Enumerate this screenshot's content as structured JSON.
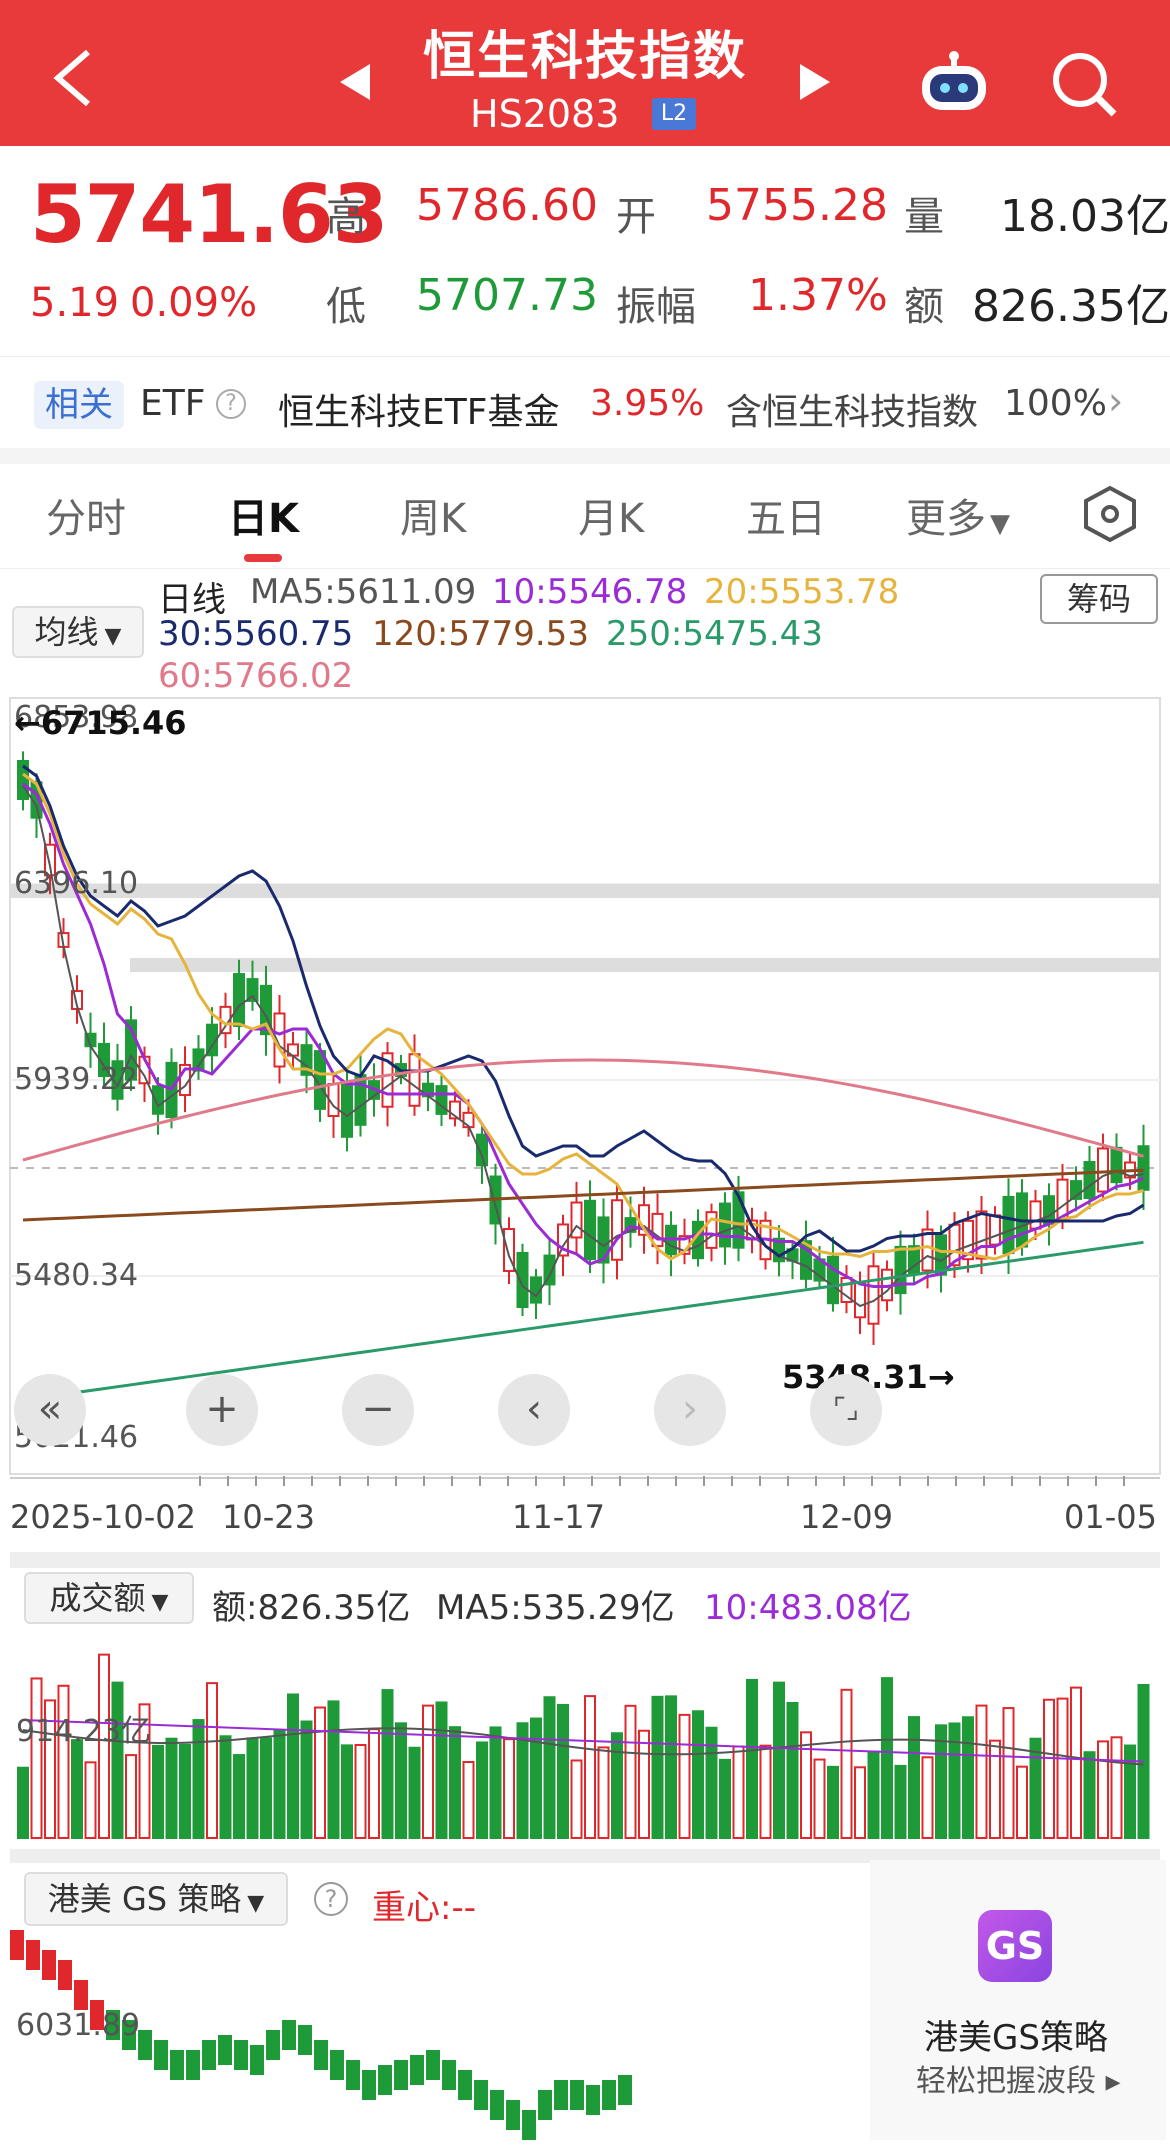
{
  "header": {
    "title": "恒生科技指数",
    "code": "HS2083",
    "badge": "L2"
  },
  "quote": {
    "price": "5741.63",
    "change": "5.19",
    "change_pct": "0.09%",
    "high_label": "高",
    "high": "5786.60",
    "open_label": "开",
    "open": "5755.28",
    "volume_label": "量",
    "volume": "18.03亿",
    "low_label": "低",
    "low": "5707.73",
    "amplitude_label": "振幅",
    "amplitude": "1.37%",
    "turnover_label": "额",
    "turnover": "826.35亿"
  },
  "etf": {
    "tag": "相关",
    "label": "ETF",
    "fund": "恒生科技ETF基金",
    "fund_pct": "3.95%",
    "contains": "含恒生科技指数",
    "contains_pct": "100%"
  },
  "tabs": [
    "分时",
    "日K",
    "周K",
    "月K",
    "五日",
    "更多"
  ],
  "kline": {
    "ma_button": "均线",
    "chip_button": "筹码",
    "period": "日线",
    "ma5": "MA5:5611.09",
    "ma10": "10:5546.78",
    "ma20": "20:5553.78",
    "ma30": "30:5560.75",
    "ma120": "120:5779.53",
    "ma250": "250:5475.43",
    "ma60": "60:5766.02",
    "high_mark": "←6715.46",
    "low_mark": "5348.31→",
    "y_labels": [
      "6853.98",
      "6396.10",
      "5939.22",
      "5480.34",
      "5021.46"
    ],
    "x_labels": [
      "2025-10-02",
      "10-23",
      "11-17",
      "12-09",
      "01-05"
    ]
  },
  "volume": {
    "button": "成交额",
    "amount": "额:826.35亿",
    "ma5": "MA5:535.29亿",
    "ma10": "10:483.08亿",
    "y_label": "914.23亿"
  },
  "gs": {
    "button": "港美 GS 策略",
    "center": "重心:--",
    "y_label": "6031.89",
    "promo_icon": "GS",
    "promo_title": "港美GS策略",
    "promo_sub": "轻松把握波段"
  },
  "colors": {
    "up": "#e0282c",
    "down": "#1f9a38",
    "ma5": "#555555",
    "ma10": "#9b2bd4",
    "ma20": "#e6b43c",
    "ma30": "#1a2a6e",
    "ma120": "#8a4a1e",
    "ma250": "#2a9a6a",
    "ma60": "#e07a8a"
  }
}
